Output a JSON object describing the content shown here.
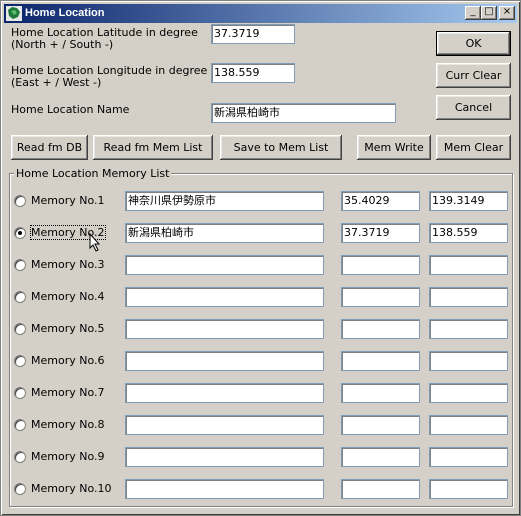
{
  "window": {
    "title": "Home Location",
    "minimize_glyph": "_",
    "maximize_glyph": "□",
    "close_glyph": "×"
  },
  "fields": {
    "lat_label_1": "Home Location Latitude in degree",
    "lat_label_2": "(North + / South -)",
    "lat_value": "37.3719",
    "lon_label_1": "Home Location Longitude in degree",
    "lon_label_2": "(East + / West -)",
    "lon_value": "138.559",
    "name_label": "Home Location Name",
    "name_value": "新潟県柏崎市"
  },
  "buttons": {
    "ok": "OK",
    "curr_clear": "Curr Clear",
    "cancel": "Cancel",
    "read_db": "Read fm DB",
    "read_mem": "Read fm Mem List",
    "save_mem": "Save to Mem List",
    "mem_write": "Mem Write",
    "mem_clear": "Mem Clear"
  },
  "memory_list": {
    "title": "Home Location Memory List",
    "selected_index": 1,
    "rows": [
      {
        "label": "Memory No.1",
        "name": "神奈川県伊勢原市",
        "lat": "35.4029",
        "lon": "139.3149"
      },
      {
        "label": "Memory No.2",
        "name": "新潟県柏崎市",
        "lat": "37.3719",
        "lon": "138.559"
      },
      {
        "label": "Memory No.3",
        "name": "",
        "lat": "",
        "lon": ""
      },
      {
        "label": "Memory No.4",
        "name": "",
        "lat": "",
        "lon": ""
      },
      {
        "label": "Memory No.5",
        "name": "",
        "lat": "",
        "lon": ""
      },
      {
        "label": "Memory No.6",
        "name": "",
        "lat": "",
        "lon": ""
      },
      {
        "label": "Memory No.7",
        "name": "",
        "lat": "",
        "lon": ""
      },
      {
        "label": "Memory No.8",
        "name": "",
        "lat": "",
        "lon": ""
      },
      {
        "label": "Memory No.9",
        "name": "",
        "lat": "",
        "lon": ""
      },
      {
        "label": "Memory No.10",
        "name": "",
        "lat": "",
        "lon": ""
      }
    ]
  }
}
